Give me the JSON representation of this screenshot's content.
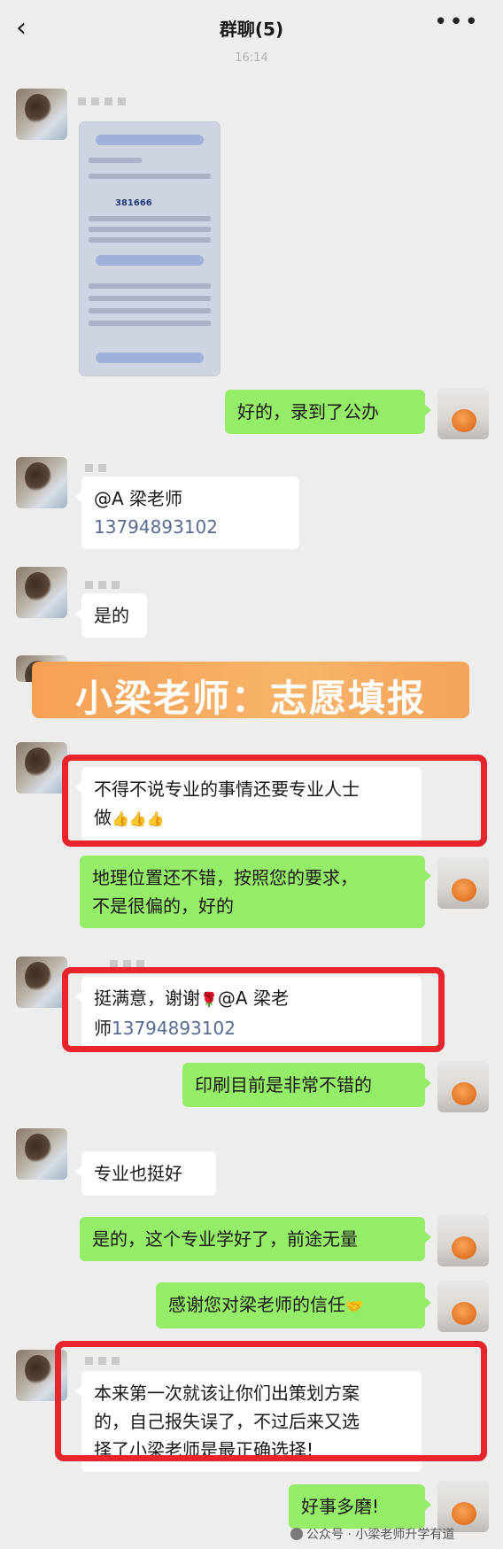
{
  "header": {
    "title": "群聊(5)",
    "back_icon": "chevron-left-icon",
    "more_label": "•••"
  },
  "timestamp": "16:14",
  "screenshot_preview": {
    "code": "381666"
  },
  "messages": {
    "m1": "好的，录到了公办",
    "m2_line1": "@A 梁老师",
    "m2_phone": "13794893102",
    "m3": "是的",
    "banner": "小梁老师：志愿填报",
    "m4_line1": "不得不说专业的事情还要专业人士",
    "m4_line2": "做",
    "m4_emoji": "👍👍👍",
    "m5_line1": "地理位置还不错，按照您的要求，",
    "m5_line2": "不是很偏的，好的",
    "m6_line1_a": "挺满意，谢谢",
    "m6_line1_b": "@A 梁老",
    "m6_rose": "🌹",
    "m6_line2_a": "师",
    "m6_phone": "13794893102",
    "m7": "印刷目前是非常不错的",
    "m8": "专业也挺好",
    "m9": "是的，这个专业学好了，前途无量",
    "m10": "感谢您对梁老师的信任",
    "m10_emoji": "🤝",
    "m11_line1": "本来第一次就该让你们出策划方案",
    "m11_line2": "的，自己报失误了，不过后来又选",
    "m11_line3": "择了小梁老师是最正确选择!",
    "m12": "好事多磨!"
  },
  "watermark": "公众号 · 小梁老师升学有道"
}
